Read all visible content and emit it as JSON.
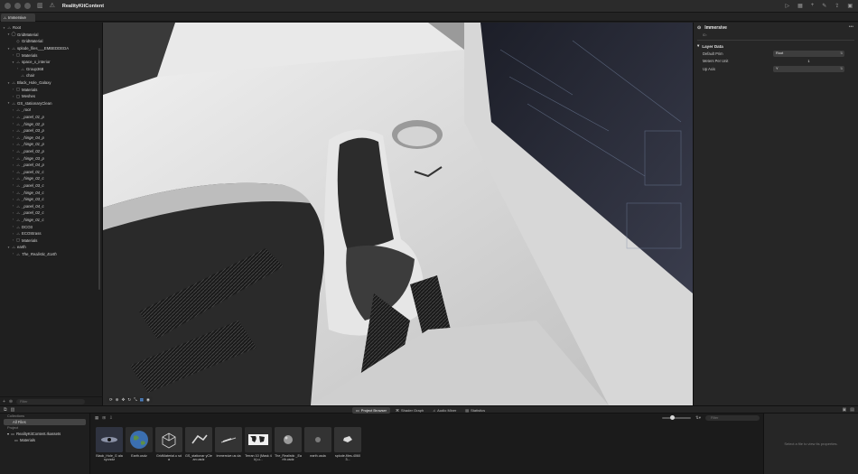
{
  "window": {
    "title": "RealityKitContent"
  },
  "tabs": [
    {
      "label": "Immersive"
    }
  ],
  "hierarchy": {
    "filter_placeholder": "Filter",
    "rows": [
      {
        "label": "Root",
        "depth": 0,
        "chev": "▾",
        "icon": "⛬",
        "italic": false
      },
      {
        "label": "GridMaterial",
        "depth": 1,
        "chev": "▾",
        "icon": "◯",
        "italic": false
      },
      {
        "label": "GridMaterial",
        "depth": 2,
        "chev": "",
        "icon": "◇",
        "italic": false
      },
      {
        "label": "splode_files___EMBEDDEDA",
        "depth": 1,
        "chev": "▾",
        "icon": "⛬",
        "italic": false
      },
      {
        "label": "Materials",
        "depth": 2,
        "chev": "›",
        "icon": "▢",
        "italic": false
      },
      {
        "label": "space_x_interior",
        "depth": 2,
        "chev": "▾",
        "icon": "⛬",
        "italic": false
      },
      {
        "label": "Group368",
        "depth": 3,
        "chev": "›",
        "icon": "⛬",
        "italic": false
      },
      {
        "label": "chair",
        "depth": 3,
        "chev": "",
        "icon": "⛬",
        "italic": false
      },
      {
        "label": "Black_Hole_Galaxy",
        "depth": 1,
        "chev": "▾",
        "icon": "⛬",
        "italic": false
      },
      {
        "label": "Materials",
        "depth": 2,
        "chev": "›",
        "icon": "▢",
        "italic": false
      },
      {
        "label": "Meshes",
        "depth": 2,
        "chev": "›",
        "icon": "▢",
        "italic": false
      },
      {
        "label": "GS_stationaryClean",
        "depth": 1,
        "chev": "▾",
        "icon": "⛬",
        "italic": false
      },
      {
        "label": "_root",
        "depth": 2,
        "chev": "›",
        "icon": "⛬",
        "italic": true
      },
      {
        "label": "_panel_01_p",
        "depth": 2,
        "chev": "›",
        "icon": "⛬",
        "italic": true
      },
      {
        "label": "_hinge_02_p",
        "depth": 2,
        "chev": "›",
        "icon": "⛬",
        "italic": true
      },
      {
        "label": "_panel_03_p",
        "depth": 2,
        "chev": "›",
        "icon": "⛬",
        "italic": true
      },
      {
        "label": "_hinge_04_p",
        "depth": 2,
        "chev": "›",
        "icon": "⛬",
        "italic": true
      },
      {
        "label": "_hinge_01_p",
        "depth": 2,
        "chev": "›",
        "icon": "⛬",
        "italic": true
      },
      {
        "label": "_panel_02_p",
        "depth": 2,
        "chev": "›",
        "icon": "⛬",
        "italic": true
      },
      {
        "label": "_hinge_03_p",
        "depth": 2,
        "chev": "›",
        "icon": "⛬",
        "italic": true
      },
      {
        "label": "_panel_04_p",
        "depth": 2,
        "chev": "›",
        "icon": "⛬",
        "italic": true
      },
      {
        "label": "_panel_01_c",
        "depth": 2,
        "chev": "›",
        "icon": "⛬",
        "italic": true
      },
      {
        "label": "_hinge_02_c",
        "depth": 2,
        "chev": "›",
        "icon": "⛬",
        "italic": true
      },
      {
        "label": "_panel_03_c",
        "depth": 2,
        "chev": "›",
        "icon": "⛬",
        "italic": true
      },
      {
        "label": "_hinge_04_c",
        "depth": 2,
        "chev": "›",
        "icon": "⛬",
        "italic": true
      },
      {
        "label": "_hinge_03_c",
        "depth": 2,
        "chev": "›",
        "icon": "⛬",
        "italic": true
      },
      {
        "label": "_panel_04_c",
        "depth": 2,
        "chev": "›",
        "icon": "⛬",
        "italic": true
      },
      {
        "label": "_panel_02_c",
        "depth": 2,
        "chev": "›",
        "icon": "⛬",
        "italic": true
      },
      {
        "label": "_hinge_01_c",
        "depth": 2,
        "chev": "›",
        "icon": "⛬",
        "italic": true
      },
      {
        "label": "DCO3",
        "depth": 2,
        "chev": "›",
        "icon": "⛬",
        "italic": false
      },
      {
        "label": "ECOStrass",
        "depth": 2,
        "chev": "›",
        "icon": "⛬",
        "italic": false
      },
      {
        "label": "Materials",
        "depth": 2,
        "chev": "›",
        "icon": "▢",
        "italic": false
      },
      {
        "label": "earth",
        "depth": 1,
        "chev": "▾",
        "icon": "⛬",
        "italic": false
      },
      {
        "label": "The_Realistic_Earth",
        "depth": 2,
        "chev": "›",
        "icon": "⛬",
        "italic": true
      }
    ]
  },
  "inspector": {
    "title": "Immersive",
    "subtitle": "ID:",
    "section_title": "Layer Data",
    "properties": [
      {
        "label": "Default Prim",
        "value": "Root",
        "kind": "popup"
      },
      {
        "label": "Meters Per Unit",
        "value": "1",
        "kind": "number"
      },
      {
        "label": "Up Axis",
        "value": "Y",
        "kind": "popup"
      }
    ]
  },
  "bottom_tabs": [
    {
      "label": "Project Browser",
      "icon": "▭",
      "active": true
    },
    {
      "label": "Shader Graph",
      "icon": "⌘",
      "active": false
    },
    {
      "label": "Audio Mixer",
      "icon": "♫",
      "active": false
    },
    {
      "label": "Statistics",
      "icon": "▤",
      "active": false
    }
  ],
  "collections": {
    "collections_header": "Collections",
    "all_files": "All Files",
    "project_header": "Project",
    "project_items": [
      {
        "label": "RealityKitContent.rkassets",
        "chev": "▾",
        "indent": 0
      },
      {
        "label": "Materials",
        "chev": "",
        "indent": 1
      }
    ]
  },
  "browser": {
    "filter_placeholder": "Filter",
    "zoom_level": 0.35,
    "files": [
      {
        "name": "Black_Hole_G alaxy.usdz",
        "thumb": "galaxy"
      },
      {
        "name": "Earth.usdz",
        "thumb": "earth"
      },
      {
        "name": "GridMaterial.u sda",
        "thumb": "cube"
      },
      {
        "name": "GS_stationar yClean.usdz",
        "thumb": "station"
      },
      {
        "name": "Immersive.us da",
        "thumb": "immersive"
      },
      {
        "name": "Terran 10 (Mask 4k).u...",
        "thumb": "map"
      },
      {
        "name": "The_Realistic _Earth.usdz",
        "thumb": "realistic"
      },
      {
        "name": "earth.usda",
        "thumb": "small-earth"
      },
      {
        "name": "splode-files-40603...",
        "thumb": "splode"
      }
    ]
  },
  "properties_panel": {
    "empty_text": "Select a file to view its properties."
  }
}
